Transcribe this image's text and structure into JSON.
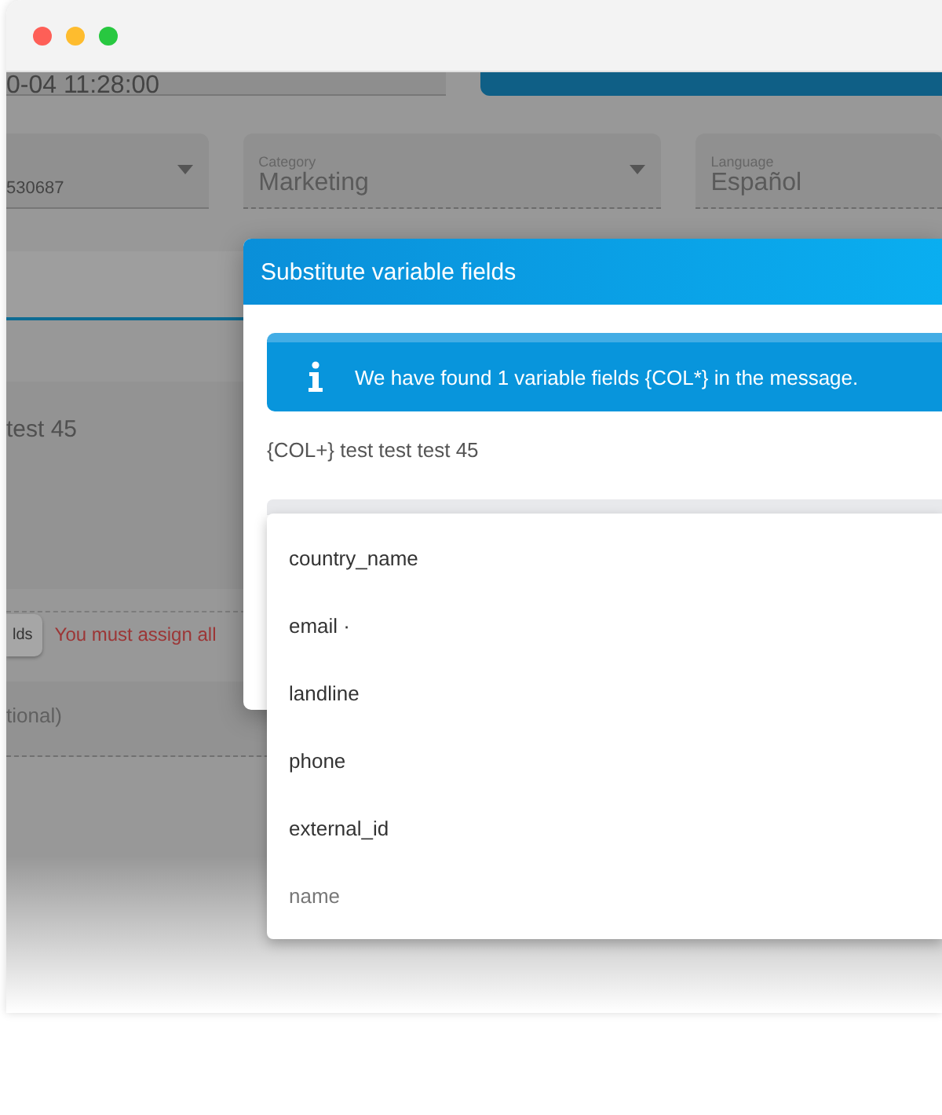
{
  "background": {
    "date_field": {
      "value": "0-04 11:28:00"
    },
    "selects": [
      {
        "value": "530687"
      },
      {
        "label": "Category",
        "value": "Marketing"
      },
      {
        "label": "Language",
        "value": "Español"
      }
    ],
    "message_preview": "test 45",
    "assign_button": "lds",
    "error": "You must assign all",
    "optional_field": {
      "placeholder": "tional)"
    }
  },
  "modal": {
    "title": "Substitute variable fields",
    "info": "We have found 1 variable fields {COL*} in the message.",
    "message": "{COL+} test test test 45",
    "options": [
      {
        "label": "country_name",
        "disabled": false
      },
      {
        "label": "email ·",
        "disabled": false
      },
      {
        "label": "landline",
        "disabled": false
      },
      {
        "label": "phone",
        "disabled": false
      },
      {
        "label": "external_id",
        "disabled": false
      },
      {
        "label": "name",
        "disabled": true
      }
    ]
  }
}
